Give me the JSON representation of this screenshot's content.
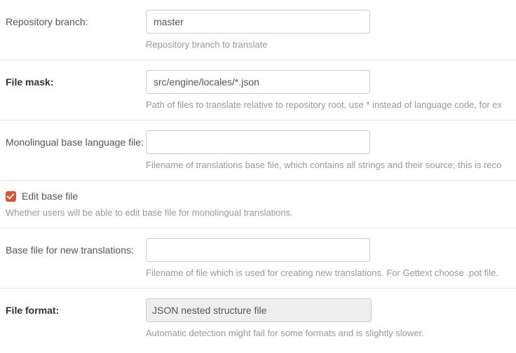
{
  "rows": {
    "repo_branch": {
      "label": "Repository branch:",
      "value": "master",
      "help": "Repository branch to translate"
    },
    "file_mask": {
      "label": "File mask:",
      "value": "src/engine/locales/*.json",
      "help": "Path of files to translate relative to repository root, use * instead of language code, for ex"
    },
    "mono_base": {
      "label": "Monolingual base language file:",
      "value": "",
      "help": "Filename of translations base file, which contains all strings and their source; this is reco"
    },
    "edit_base": {
      "label": "Edit base file",
      "checked": true,
      "help": "Whether users will be able to edit base file for monolingual translations."
    },
    "base_new": {
      "label": "Base file for new translations:",
      "value": "",
      "help": "Filename of file which is used for creating new translations. For Gettext choose .pot file."
    },
    "file_format": {
      "label": "File format:",
      "value": "JSON nested structure file",
      "help": "Automatic detection might fail for some formats and is slightly slower."
    }
  }
}
